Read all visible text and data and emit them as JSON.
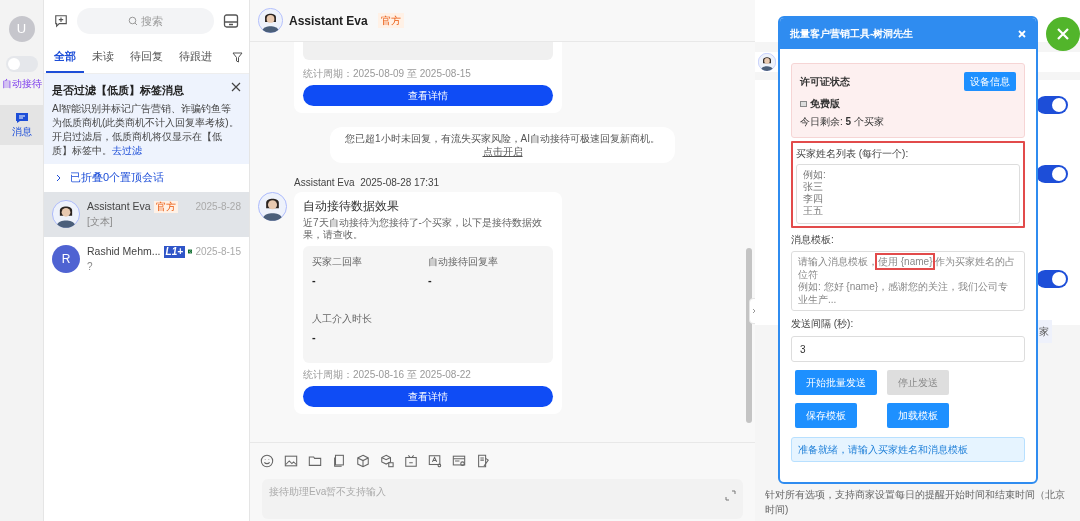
{
  "rail": {
    "avatar": "U",
    "auto_reply": {
      "label": "自动接待",
      "on": false
    },
    "nav": [
      {
        "label": "消息",
        "selected": true
      }
    ]
  },
  "list": {
    "search": {
      "placeholder": "搜索"
    },
    "tabs": [
      {
        "label": "全部",
        "selected": true
      },
      {
        "label": "未读",
        "selected": false
      },
      {
        "label": "待回复",
        "selected": false
      },
      {
        "label": "待跟进",
        "selected": false
      }
    ],
    "notice": {
      "title": "是否过滤【低质】标签消息",
      "body": "AI智能识别并标记广告营销、诈骗钓鱼等为低质商机(此类商机不计入回复率考核)。开启过滤后，低质商机将仅显示在【低质】标签中。",
      "link": "去过滤"
    },
    "pinned": "已折叠0个置顶会话",
    "conversations": [
      {
        "kind": "official",
        "name": "Assistant Eva",
        "badge": "官方",
        "date": "2025-8-28",
        "preview": "[文本]",
        "selected": true
      },
      {
        "kind": "contact",
        "name": "Rashid Mehm...",
        "badge": "L1+",
        "date": "2025-8-15",
        "preview": "?",
        "initial": "R",
        "flag": true,
        "selected": false
      }
    ]
  },
  "chat": {
    "name": "Assistant Eva",
    "badge": "官方",
    "messages": [
      {
        "kind": "card_tail",
        "period": "统计周期：2025-08-09 至 2025-08-15",
        "button": "查看详情"
      },
      {
        "kind": "system",
        "text": "您已超1小时未回复，有流失买家风险，AI自动接待可极速回复新商机。",
        "link": "点击开启"
      },
      {
        "kind": "card",
        "sender": "Assistant Eva",
        "time": "2025-08-28 17:31",
        "title": "自动接待数据效果",
        "desc": "近7天自动接待为您接待了-个买家，以下是接待数据效果，请查收。",
        "metrics": [
          {
            "label": "买家二回率",
            "value": "-"
          },
          {
            "label": "自动接待回复率",
            "value": "-"
          },
          {
            "label": "人工介入时长",
            "value": "-"
          }
        ],
        "period": "统计周期：2025-08-16 至 2025-08-22",
        "button": "查看详情"
      }
    ],
    "input": {
      "placeholder": "接待助理Eva暂不支持输入"
    }
  },
  "settings": {
    "toggles": [
      {
        "on": true
      },
      {
        "on": true
      },
      {
        "on": true
      }
    ],
    "chip": "家",
    "footnote": "针对所有选项，支持商家设置每日的提醒开始时间和结束时间（北京时间)"
  },
  "dialog": {
    "title": "批量客户营销工具-树洞先生",
    "license": {
      "title": "许可证状态",
      "button": "设备信息",
      "plan": "免费版",
      "remaining": "今日剩余: **5** 个买家"
    },
    "names": {
      "label": "买家姓名列表 (每行一个):",
      "placeholder_lines": [
        "例如:",
        "张三",
        "李四",
        "王五"
      ],
      "highlighted": true
    },
    "template": {
      "label": "消息模板:",
      "placeholder_segments": [
        {
          "text": "请输入消息模板，",
          "highlighted": false
        },
        {
          "text": "使用 {name}",
          "highlighted": true
        },
        {
          "text": " 作为买家姓名的占位符",
          "highlighted": false
        },
        {
          "text": "例如: 您好 {name}，感谢您的关注，我们公司专业生产...",
          "highlighted": false,
          "new_line": true
        }
      ]
    },
    "interval": {
      "label": "发送间隔 (秒):",
      "value": "3"
    },
    "buttons": [
      {
        "label": "开始批量发送",
        "disabled": false
      },
      {
        "label": "停止发送",
        "disabled": true
      },
      {
        "label": "保存模板",
        "disabled": false
      },
      {
        "label": "加载模板",
        "disabled": false
      }
    ],
    "status": "准备就绪，请输入买家姓名和消息模板"
  }
}
